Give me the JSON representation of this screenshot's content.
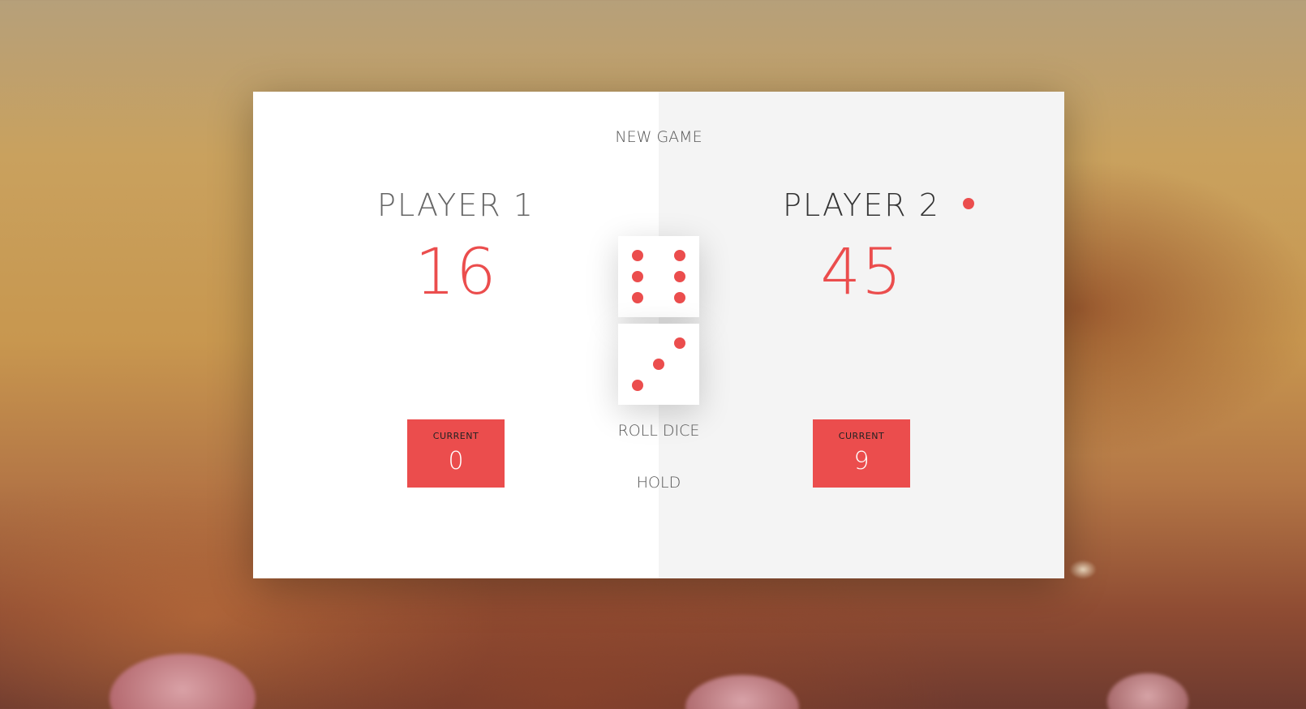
{
  "buttons": {
    "new_game": "NEW GAME",
    "roll_dice": "ROLL DICE",
    "hold": "HOLD"
  },
  "players": [
    {
      "name": "PLAYER 1",
      "score": "16",
      "current_label": "CURRENT",
      "current_score": "0",
      "active": false
    },
    {
      "name": "PLAYER 2",
      "score": "45",
      "current_label": "CURRENT",
      "current_score": "9",
      "active": true
    }
  ],
  "dice": [
    {
      "face": 6
    },
    {
      "face": 3
    }
  ],
  "colors": {
    "accent": "#EB4D4D",
    "panel_left": "#ffffff",
    "panel_right": "#f4f4f4",
    "text": "#555555"
  }
}
